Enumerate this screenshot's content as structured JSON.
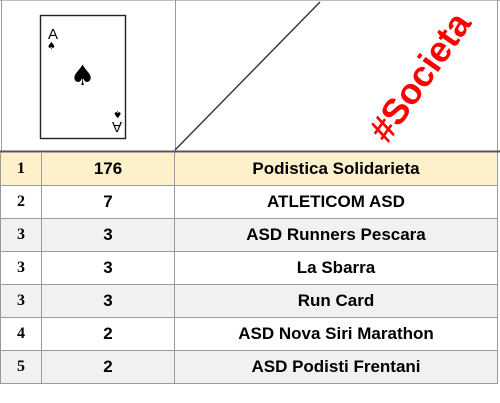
{
  "header": {
    "card": {
      "rank": "A",
      "suit": "spade",
      "suit_glyph": "♠"
    },
    "hashtag": "#Societa",
    "hashtag_color": "#ff0000"
  },
  "colors": {
    "highlight_row": "#fdf1cc",
    "alt_row": "#f1f1f1",
    "grid": "#9a9a9a"
  },
  "table": {
    "rows": [
      {
        "rank": "1",
        "count": "176",
        "name": "Podistica Solidarieta",
        "style": "yellow"
      },
      {
        "rank": "2",
        "count": "7",
        "name": "ATLETICOM ASD",
        "style": "white"
      },
      {
        "rank": "3",
        "count": "3",
        "name": "ASD Runners Pescara",
        "style": "gray"
      },
      {
        "rank": "3",
        "count": "3",
        "name": "La Sbarra",
        "style": "white"
      },
      {
        "rank": "3",
        "count": "3",
        "name": "Run Card",
        "style": "gray"
      },
      {
        "rank": "4",
        "count": "2",
        "name": "ASD Nova Siri Marathon",
        "style": "white"
      },
      {
        "rank": "5",
        "count": "2",
        "name": "ASD Podisti Frentani",
        "style": "gray"
      }
    ]
  }
}
